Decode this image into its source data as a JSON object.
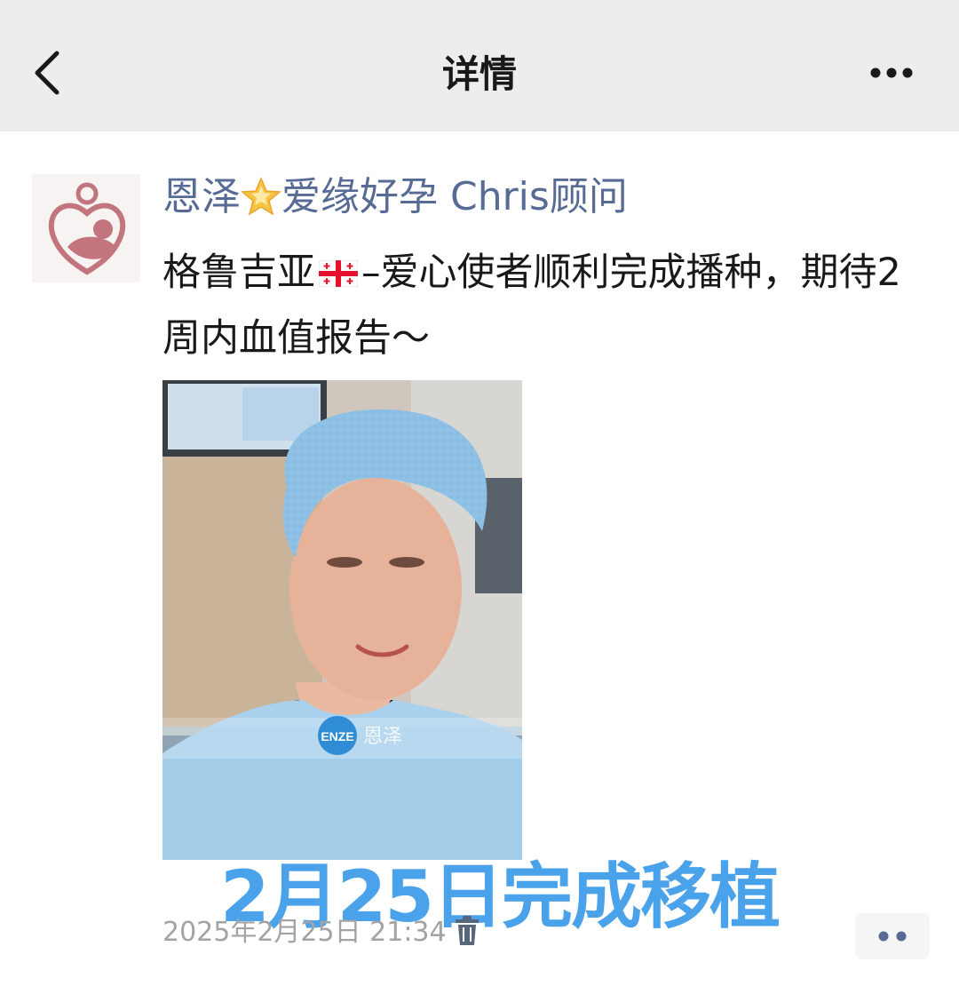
{
  "header": {
    "title": "详情",
    "back_icon": "chevron-left-icon",
    "more_icon": "ellipsis-icon"
  },
  "post": {
    "author_prefix": "恩泽",
    "author_suffix": "爱缘好孕 Chris顾问",
    "text_part1": "格鲁吉亚",
    "text_part2": "–爱心使者顺利完成播种，期待2周内血值报告～",
    "photo_logo_text": "ENZE",
    "photo_logo_cn": "恩泽",
    "overlay_caption": "2月25日完成移植",
    "timestamp": "2025年2月25日 21:34"
  },
  "colors": {
    "header_bg": "#ededed",
    "author_name": "#576b95",
    "caption_blue": "#4aa3ea",
    "timestamp_gray": "#a3a3a3"
  }
}
